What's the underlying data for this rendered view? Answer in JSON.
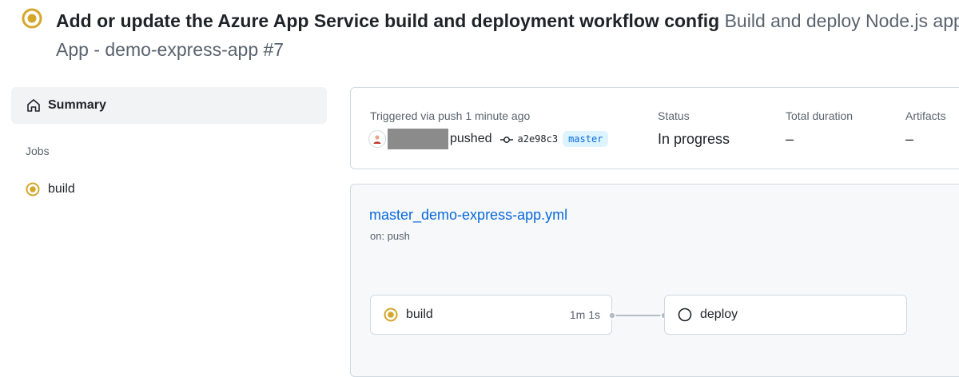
{
  "header": {
    "title": "Add or update the Azure App Service build and deployment workflow config",
    "subtitle_line1": "Build and deploy Node.js app to Azure Web",
    "subtitle_line2": "App - demo-express-app #7",
    "status_icon": "in-progress-icon",
    "status_color": "#d4a72c"
  },
  "sidebar": {
    "summary_label": "Summary",
    "summary_icon": "home-icon",
    "jobs_heading": "Jobs",
    "jobs": [
      {
        "label": "build",
        "status": "in-progress"
      }
    ]
  },
  "run_summary": {
    "trigger_label": "Triggered via push 1 minute ago",
    "pushed_text": "pushed",
    "commit_sha": "a2e98c3",
    "branch": "master",
    "status_label": "Status",
    "status_value": "In progress",
    "duration_label": "Total duration",
    "duration_value": "–",
    "artifacts_label": "Artifacts",
    "artifacts_value": "–"
  },
  "workflow": {
    "file_name": "master_demo-express-app.yml",
    "trigger": "on: push",
    "jobs": [
      {
        "label": "build",
        "time": "1m 1s",
        "status": "in-progress"
      },
      {
        "label": "deploy",
        "time": "",
        "status": "queued"
      }
    ]
  },
  "colors": {
    "accent": "#0969da",
    "in_progress": "#d4a72c",
    "border": "#d1d9e0",
    "muted_text": "#59636e"
  }
}
